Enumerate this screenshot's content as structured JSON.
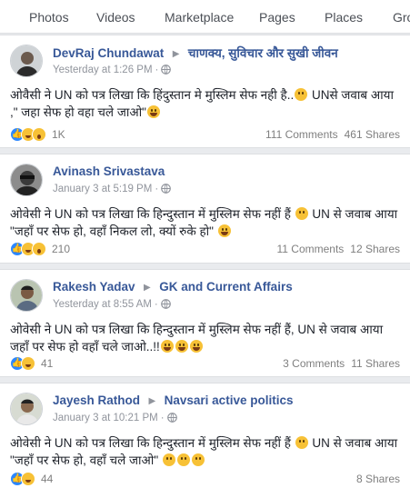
{
  "tabs": [
    "Photos",
    "Videos",
    "Marketplace",
    "Pages",
    "Places",
    "Gro"
  ],
  "posts": [
    {
      "author": "DevRaj Chundawat",
      "group": "चाणक्य, सुविचार और सुखी जीवन",
      "time": "Yesterday at 1:26 PM",
      "line1": "ओवैसी ने UN को पत्र लिखा कि हिंदुस्तान मे मुस्लिम सेफ नही है..",
      "line1b": " UNसे जवाब आया",
      "line2": ",\" जहा सेफ हो वहा चले जाओ\"",
      "reaction_count": "1K",
      "comments": "111 Comments",
      "shares": "461 Shares"
    },
    {
      "author": "Avinash Srivastava",
      "group": "",
      "time": "January 3 at 5:19 PM",
      "line1": "ओवेसी ने UN को पत्र लिखा कि हिन्दुस्तान में मुस्लिम सेफ नहीं हैं",
      "line1b": " UN से जवाब आया",
      "line2": "\"जहाँ पर सेफ हो, वहाँ निकल लो, क्यों रुके हो\"",
      "reaction_count": "210",
      "comments": "11 Comments",
      "shares": "12 Shares"
    },
    {
      "author": "Rakesh Yadav",
      "group": "GK and Current Affairs",
      "time": "Yesterday at 8:55 AM",
      "line1": "ओवेसी ने UN को पत्र लिखा कि हिन्दुस्तान में मुस्लिम सेफ नहीं हैं, UN से जवाब आया",
      "line1b": "",
      "line2": "जहाँ पर सेफ हो वहाँ चले जाओ..!!",
      "reaction_count": "41",
      "comments": "3 Comments",
      "shares": "11 Shares"
    },
    {
      "author": "Jayesh Rathod",
      "group": "Navsari active politics",
      "time": "January 3 at 10:21 PM",
      "line1": "ओवेसी ने UN को पत्र लिखा कि हिन्दुस्तान में मुस्लिम सेफ नहीं हैं",
      "line1b": " UN से जवाब आया",
      "line2": "\"जहाँ पर सेफ हो, वहाँ चले जाओ\"",
      "reaction_count": "44",
      "comments": "",
      "shares": "8 Shares"
    }
  ]
}
